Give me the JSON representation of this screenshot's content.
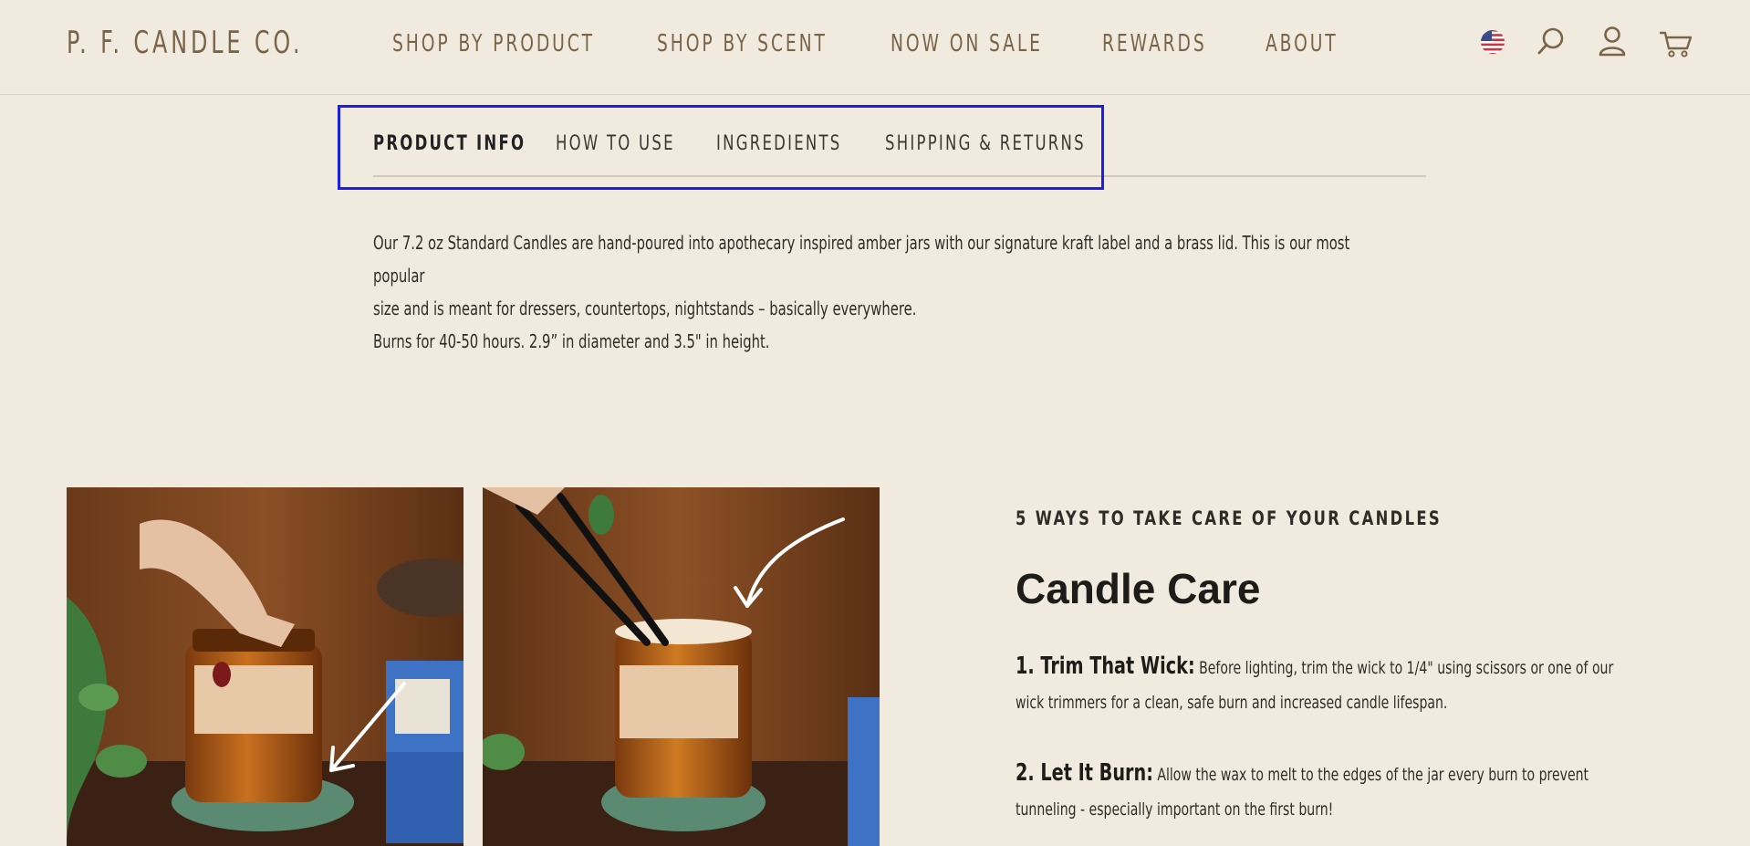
{
  "header": {
    "logo": "P. F. CANDLE CO.",
    "nav": [
      "SHOP BY PRODUCT",
      "SHOP BY SCENT",
      "NOW ON SALE",
      "REWARDS",
      "ABOUT"
    ],
    "icons": [
      "us-flag-icon",
      "search-icon",
      "account-icon",
      "cart-icon"
    ]
  },
  "tabs": {
    "items": [
      "PRODUCT INFO",
      "HOW TO USE",
      "INGREDIENTS",
      "SHIPPING & RETURNS"
    ],
    "active": "PRODUCT INFO"
  },
  "product_info": {
    "line1": "Our 7.2 oz Standard Candles are hand-poured into apothecary inspired amber jars with our signature kraft label and a brass lid. This is our most popular",
    "line2": "size and is meant for dressers, countertops, nightstands – basically everywhere.",
    "burn": "Burns for 40-50 hours. 2.9” in diameter and 3.5\" in height."
  },
  "care": {
    "kicker": "5 WAYS TO TAKE CARE OF YOUR CANDLES",
    "title": "Candle Care",
    "tips": [
      {
        "lead": "1. Trim That Wick:",
        "text1": "Before lighting, trim the wick to 1/4\" using scissors or one of our",
        "text2": "wick trimmers for a clean, safe burn and increased candle lifespan."
      },
      {
        "lead": "2. Let It Burn:",
        "text1": "Allow the wax to melt to the edges of the jar every burn to prevent",
        "text2": "tunneling - especially important on the first burn!"
      }
    ]
  },
  "colors": {
    "background": "#f1ebdf",
    "brand": "#7a6447",
    "highlight_frame": "#1a1ee6"
  }
}
